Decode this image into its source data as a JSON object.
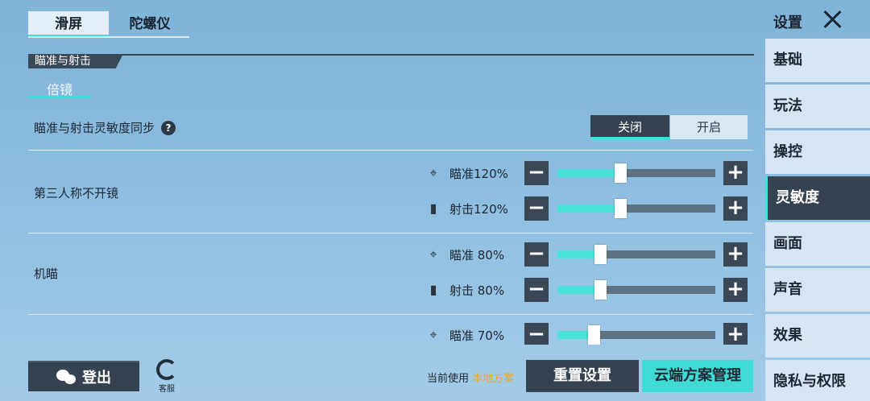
{
  "tabs": {
    "slide": "滑屏",
    "gyro": "陀螺仪"
  },
  "section": {
    "title": "瞄准与射击",
    "subtab": "倍镜"
  },
  "sync": {
    "label": "瞄准与射击灵敏度同步",
    "help_icon": "?",
    "off": "关闭",
    "on": "开启",
    "selected": "关闭"
  },
  "rows": [
    {
      "label": "第三人称不开镜",
      "sliders": [
        {
          "icon": "crosshair-icon",
          "glyph": "⌖",
          "text": "瞄准120%",
          "fraction": 0.4
        },
        {
          "icon": "bullets-icon",
          "glyph": "▮",
          "text": "射击120%",
          "fraction": 0.4
        }
      ]
    },
    {
      "label": "机瞄",
      "sliders": [
        {
          "icon": "crosshair-icon",
          "glyph": "⌖",
          "text": "瞄准  80%",
          "fraction": 0.27
        },
        {
          "icon": "bullets-icon",
          "glyph": "▮",
          "text": "射击  80%",
          "fraction": 0.27
        }
      ]
    },
    {
      "label": "",
      "sliders": [
        {
          "icon": "crosshair-icon",
          "glyph": "⌖",
          "text": "瞄准  70%",
          "fraction": 0.23
        }
      ]
    }
  ],
  "controls": {
    "minus": "−",
    "plus": "+"
  },
  "bottom": {
    "login": "登出",
    "customer_service": "客服",
    "current_prefix": "当前使用",
    "current_plan": "本地方案",
    "reset": "重置设置",
    "cloud": "云端方案管理"
  },
  "sidebar": {
    "title": "设置",
    "items": [
      "基础",
      "玩法",
      "操控",
      "灵敏度",
      "画面",
      "声音",
      "效果",
      "隐私与权限"
    ],
    "active": "灵敏度"
  },
  "colors": {
    "accent": "#3ee0d8",
    "dark": "#34434f",
    "highlight": "#f2a51d"
  }
}
